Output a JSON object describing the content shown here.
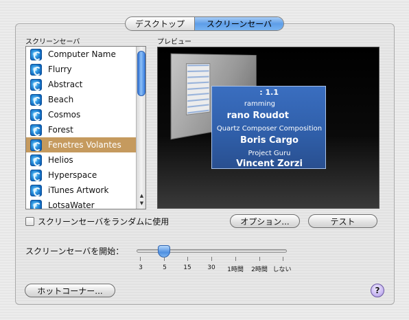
{
  "tabs": [
    {
      "label": "デスクトップ",
      "selected": false
    },
    {
      "label": "スクリーンセーバ",
      "selected": true
    }
  ],
  "screensaver_list": {
    "header": "スクリーンセーバ",
    "items": [
      {
        "label": "Computer Name",
        "selected": false
      },
      {
        "label": "Flurry",
        "selected": false
      },
      {
        "label": "Abstract",
        "selected": false
      },
      {
        "label": "Beach",
        "selected": false
      },
      {
        "label": "Cosmos",
        "selected": false
      },
      {
        "label": "Forest",
        "selected": false
      },
      {
        "label": "Fenetres Volantes",
        "selected": true
      },
      {
        "label": "Helios",
        "selected": false
      },
      {
        "label": "Hyperspace",
        "selected": false
      },
      {
        "label": "iTunes Artwork",
        "selected": false
      },
      {
        "label": "LotsaWater",
        "selected": false
      }
    ]
  },
  "preview": {
    "header": "プレビュー",
    "card_lines": [
      ": 1.1",
      "ramming",
      "rano Roudot",
      "Quartz Composer Composition",
      "Boris Cargo",
      "Project Guru",
      "Vincent Zorzi"
    ]
  },
  "options": {
    "random_checkbox_label": "スクリーンセーバをランダムに使用",
    "random_checked": false,
    "options_button": "オプション...",
    "test_button": "テスト"
  },
  "start_slider": {
    "label": "スクリーンセーバを開始：",
    "selected_value": "5",
    "ticks": [
      "3",
      "5",
      "15",
      "30",
      "1時間",
      "2時間",
      "しない"
    ]
  },
  "hot_corners_button": "ホットコーナー...",
  "help_button": "?"
}
